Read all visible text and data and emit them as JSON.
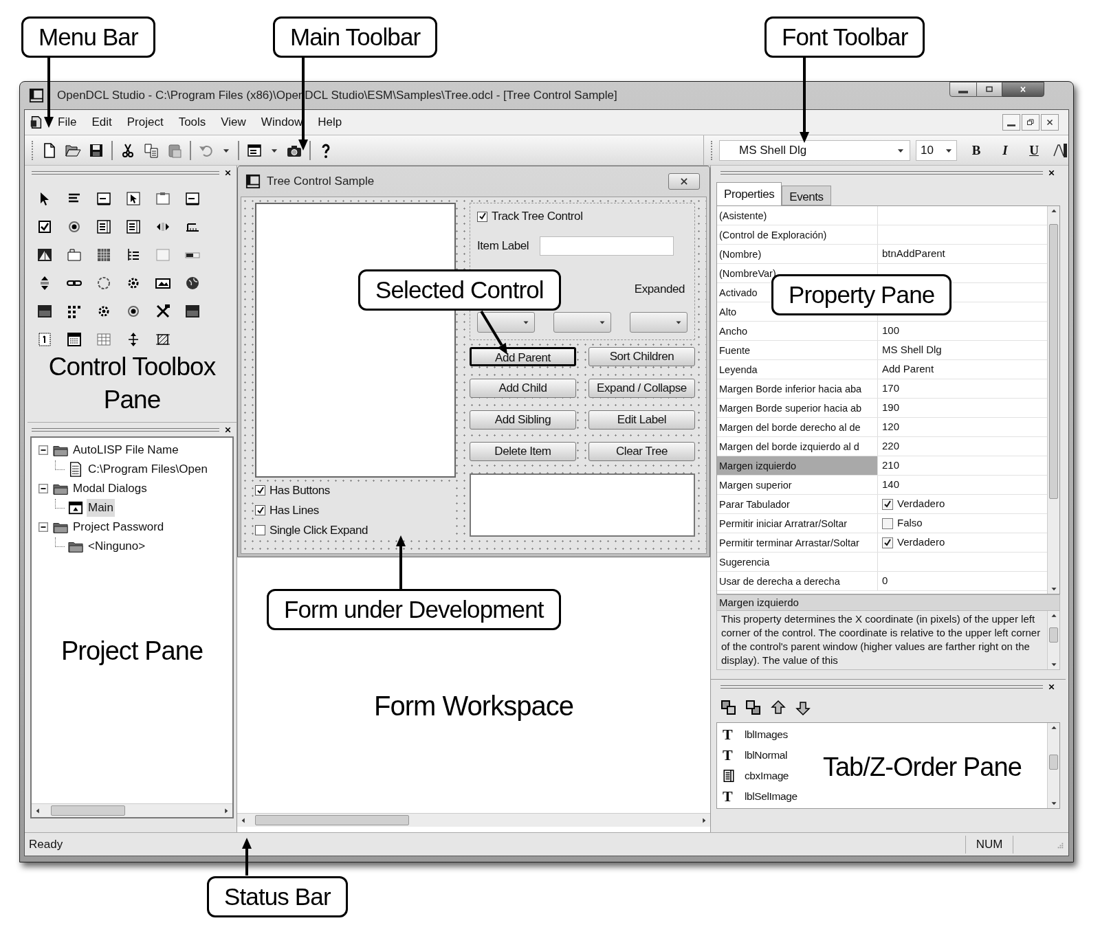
{
  "callouts": [
    {
      "text": "Menu Bar"
    },
    {
      "text": "Main Toolbar"
    },
    {
      "text": "Font Toolbar"
    },
    {
      "text": "Selected Control"
    },
    {
      "text": "Property Pane"
    },
    {
      "text": "Form under Development"
    },
    {
      "text": "Status Bar"
    }
  ],
  "window": {
    "title": "OpenDCL Studio - C:\\Program Files (x86)\\OpenDCL Studio\\ESM\\Samples\\Tree.odcl - [Tree Control Sample]"
  },
  "menu": [
    "File",
    "Edit",
    "Project",
    "Tools",
    "View",
    "Window",
    "Help"
  ],
  "font_toolbar": {
    "font": "MS Shell Dlg",
    "size": "10",
    "style_buttons": [
      "B",
      "I",
      "U"
    ]
  },
  "toolbox": {
    "caption": "Control Toolbox Pane"
  },
  "project": {
    "caption": "Project Pane",
    "tree": [
      {
        "label": "AutoLISP File Name",
        "kind": "folder",
        "expanded": true,
        "selected": false,
        "children": [
          {
            "label": "C:\\Program Files\\Open",
            "kind": "lisp",
            "selected": false
          }
        ]
      },
      {
        "label": "Modal Dialogs",
        "kind": "folder",
        "expanded": true,
        "selected": false,
        "children": [
          {
            "label": "Main",
            "kind": "dialog",
            "selected": true
          }
        ]
      },
      {
        "label": "Project Password",
        "kind": "folder",
        "expanded": true,
        "selected": false,
        "children": [
          {
            "label": "<Ninguno>",
            "kind": "folder",
            "selected": false
          }
        ]
      }
    ]
  },
  "form": {
    "title": "Tree Control Sample",
    "options": [
      {
        "label": "Has Buttons",
        "checked": true
      },
      {
        "label": "Has Lines",
        "checked": true
      },
      {
        "label": "Single Click Expand",
        "checked": false
      }
    ],
    "track": {
      "label": "Track Tree Control",
      "checked": true
    },
    "item_label": "Item Label",
    "combo_label": "Expanded",
    "buttons": [
      {
        "label": "Add Parent",
        "selected": true
      },
      {
        "label": "Sort Children",
        "selected": false
      },
      {
        "label": "Add Child",
        "selected": false
      },
      {
        "label": "Expand / Collapse",
        "selected": false
      },
      {
        "label": "Add Sibling",
        "selected": false
      },
      {
        "label": "Edit Label",
        "selected": false
      },
      {
        "label": "Delete Item",
        "selected": false
      },
      {
        "label": "Clear Tree",
        "selected": false
      }
    ]
  },
  "workspace": {
    "caption": "Form Workspace"
  },
  "properties": {
    "tabs": [
      {
        "label": "Properties",
        "selected": true
      },
      {
        "label": "Events",
        "selected": false
      }
    ],
    "rows": [
      {
        "name": "(Asistente)",
        "kind": "text",
        "selected": false
      },
      {
        "name": "(Control de Exploración)",
        "kind": "text",
        "selected": false
      },
      {
        "name": "(Nombre)",
        "kind": "text",
        "value": "btnAddParent",
        "selected": false
      },
      {
        "name": "(NombreVar)",
        "kind": "text",
        "selected": false
      },
      {
        "name": "Activado",
        "kind": "text",
        "selected": false
      },
      {
        "name": "Alto",
        "kind": "text",
        "selected": false
      },
      {
        "name": "Ancho",
        "kind": "text",
        "value": "100",
        "selected": false
      },
      {
        "name": "Fuente",
        "kind": "text",
        "value": "MS Shell Dlg",
        "selected": false
      },
      {
        "name": "Leyenda",
        "kind": "text",
        "value": "Add Parent",
        "selected": false
      },
      {
        "name": "Margen Borde inferior hacia aba",
        "kind": "text",
        "value": "170",
        "selected": false
      },
      {
        "name": "Margen Borde superior hacia ab",
        "kind": "text",
        "value": "190",
        "selected": false
      },
      {
        "name": "Margen del borde derecho al de",
        "kind": "text",
        "value": "120",
        "selected": false
      },
      {
        "name": "Margen del borde izquierdo al d",
        "kind": "text",
        "value": "220",
        "selected": false
      },
      {
        "name": "Margen izquierdo",
        "kind": "text",
        "value": "210",
        "selected": true
      },
      {
        "name": "Margen superior",
        "kind": "text",
        "value": "140",
        "selected": false
      },
      {
        "name": "Parar Tabulador",
        "kind": "check",
        "checked": true,
        "value": "Verdadero",
        "selected": false
      },
      {
        "name": "Permitir iniciar Arratrar/Soltar",
        "kind": "check",
        "checked": false,
        "value": "Falso",
        "selected": false
      },
      {
        "name": "Permitir terminar Arrastar/Soltar",
        "kind": "check",
        "checked": true,
        "value": "Verdadero",
        "selected": false
      },
      {
        "name": "Sugerencia",
        "kind": "text",
        "selected": false
      },
      {
        "name": "Usar de derecha a derecha",
        "kind": "text",
        "value": "0",
        "selected": false
      }
    ],
    "description": {
      "title": "Margen izquierdo",
      "text": "This property determines the X coordinate (in pixels) of the upper left corner of the control. The coordinate is relative to the upper left corner of the control's parent window (higher values are farther right on the display). The value of this"
    }
  },
  "tab_order": {
    "caption": "Tab/Z-Order Pane",
    "items": [
      {
        "kind": "label",
        "glyph": "T",
        "name": "lblImages"
      },
      {
        "kind": "label",
        "glyph": "T",
        "name": "lblNormal"
      },
      {
        "kind": "combo",
        "name": "cbxImage"
      },
      {
        "kind": "label",
        "glyph": "T",
        "name": "lblSelImage"
      }
    ]
  },
  "status_bar": {
    "text": "Ready",
    "indicator": "NUM"
  }
}
